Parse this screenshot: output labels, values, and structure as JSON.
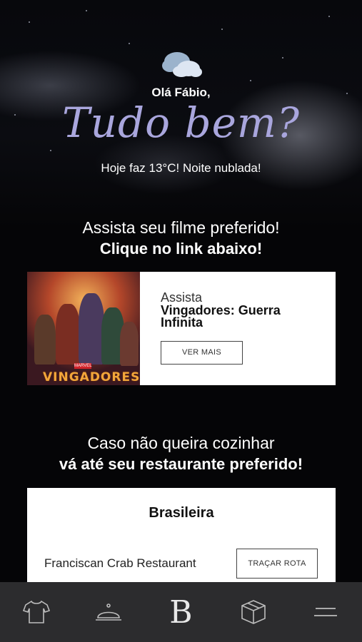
{
  "header": {
    "greeting": "Olá Fábio,",
    "headline": "Tudo bem?",
    "weather_text": "Hoje faz 13°C! Noite nublada!",
    "weather_icon": "cloud-night-icon"
  },
  "movie_section": {
    "title_line1": "Assista seu filme preferido!",
    "title_line2": "Clique no link abaixo!",
    "card": {
      "watch_label": "Assista",
      "movie_name": "Vingadores: Guerra Infinita",
      "button_label": "VER MAIS",
      "poster_logo": "VINGADORES",
      "poster_brand": "MARVEL"
    }
  },
  "restaurant_section": {
    "title_line1": "Caso não queira cozinhar",
    "title_line2": "vá até seu restaurante preferido!",
    "card": {
      "cuisine": "Brasileira",
      "restaurant_name": "Franciscan Crab Restaurant",
      "button_label": "TRAÇAR ROTA"
    }
  },
  "bottom_nav": {
    "items": [
      {
        "icon": "tshirt-icon"
      },
      {
        "icon": "food-cloche-icon"
      },
      {
        "icon": "brand-b-logo",
        "label": "B"
      },
      {
        "icon": "box-icon"
      },
      {
        "icon": "menu-icon"
      }
    ]
  },
  "colors": {
    "headline": "#a9a6dd",
    "nav_background": "#2c2c2e",
    "page_background": "#050507"
  }
}
